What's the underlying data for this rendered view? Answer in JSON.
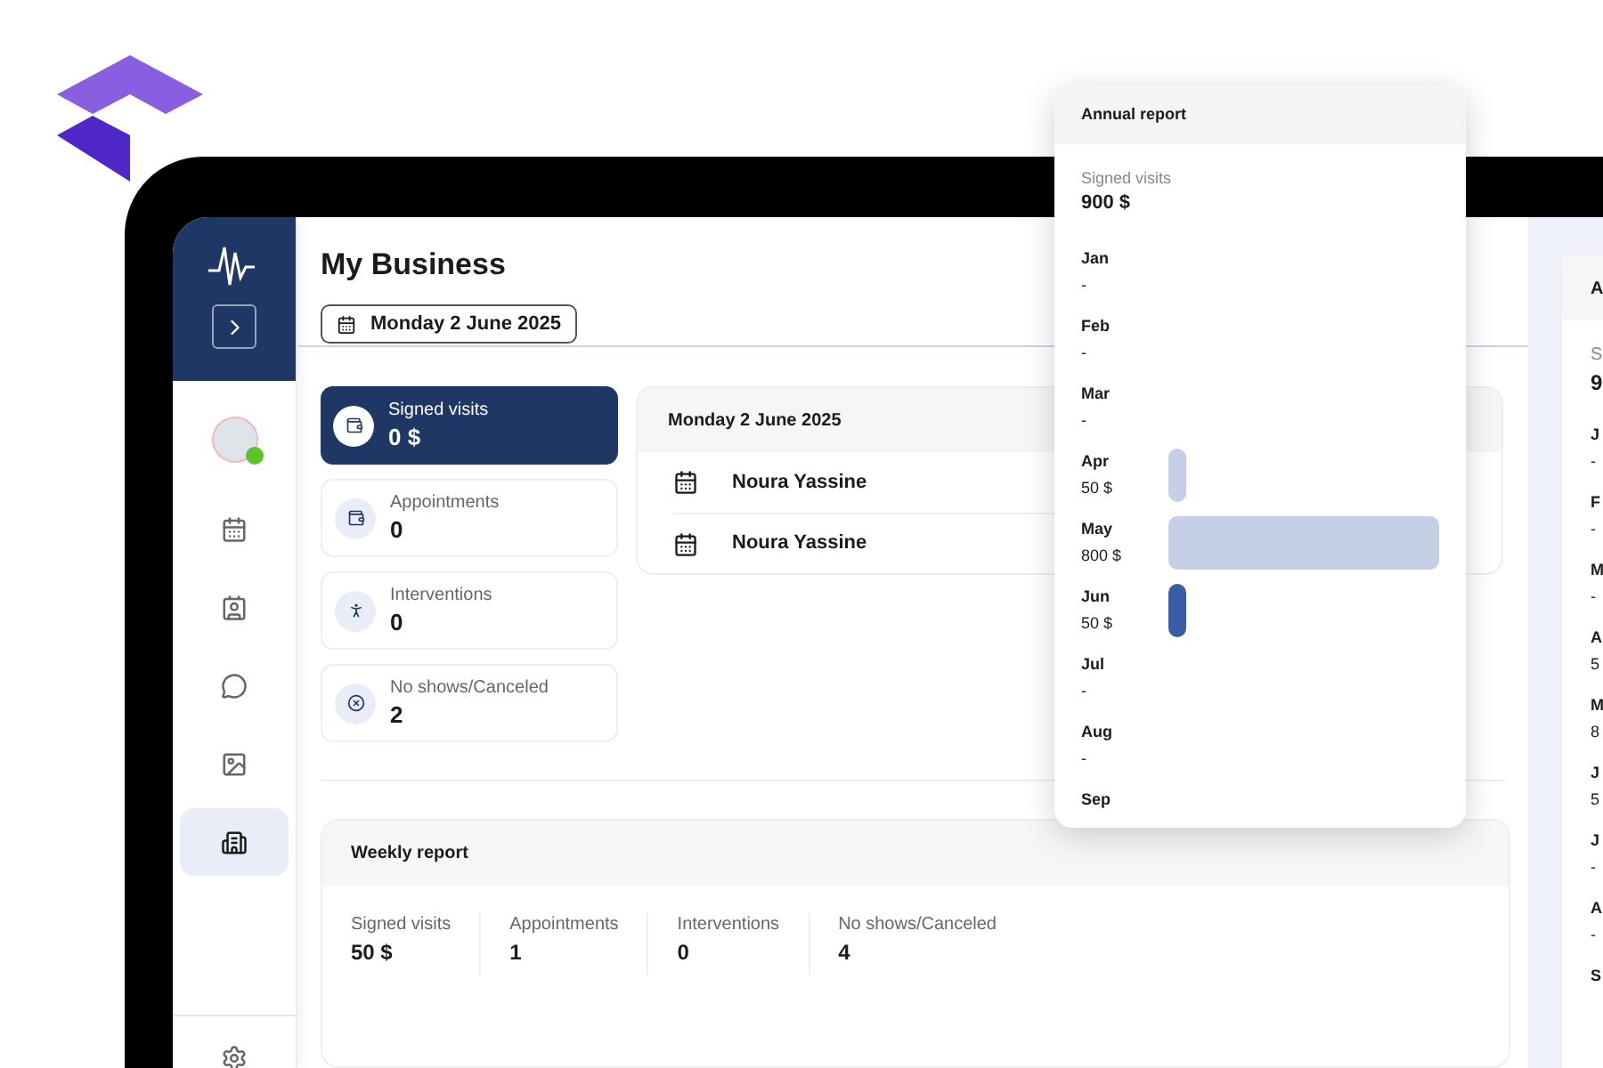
{
  "sidebar": {
    "avatar": {
      "online": true
    },
    "items": [
      {
        "selected": false
      },
      {
        "selected": false
      },
      {
        "selected": false
      },
      {
        "selected": false
      },
      {
        "selected": true
      }
    ]
  },
  "header": {
    "title": "My Business",
    "date": "Monday 2 June 2025"
  },
  "stats": [
    {
      "label": "Signed visits",
      "value": "0 $",
      "selected": true
    },
    {
      "label": "Appointments",
      "value": "0",
      "selected": false
    },
    {
      "label": "Interventions",
      "value": "0",
      "selected": false
    },
    {
      "label": "No shows/Canceled",
      "value": "2",
      "selected": false
    }
  ],
  "day_card": {
    "title": "Monday 2 June 2025",
    "rows": [
      "Noura Yassine",
      "Noura Yassine"
    ]
  },
  "weekly_report": {
    "title": "Weekly report",
    "stats": [
      {
        "label": "Signed visits",
        "value": "50 $"
      },
      {
        "label": "Appointments",
        "value": "1"
      },
      {
        "label": "Interventions",
        "value": "0"
      },
      {
        "label": "No shows/Canceled",
        "value": "4"
      }
    ]
  },
  "right_panel": {
    "title": "A",
    "summary_label": "S",
    "summary_value": "9",
    "months": [
      {
        "label": "J",
        "value": "-"
      },
      {
        "label": "F",
        "value": "-"
      },
      {
        "label": "M",
        "value": "-"
      },
      {
        "label": "A",
        "value": "5"
      },
      {
        "label": "M",
        "value": "8"
      },
      {
        "label": "J",
        "value": "5"
      },
      {
        "label": "J",
        "value": "-"
      },
      {
        "label": "A",
        "value": "-"
      },
      {
        "label": "S"
      }
    ]
  },
  "annual_report": {
    "title": "Annual report",
    "summary_label": "Signed visits",
    "summary_value": "900 $",
    "months": [
      {
        "label": "Jan",
        "value": "-"
      },
      {
        "label": "Feb",
        "value": "-"
      },
      {
        "label": "Mar",
        "value": "-"
      },
      {
        "label": "Apr",
        "value": "50 $"
      },
      {
        "label": "May",
        "value": "800 $"
      },
      {
        "label": "Jun",
        "value": "50 $"
      },
      {
        "label": "Jul",
        "value": "-"
      },
      {
        "label": "Aug",
        "value": "-"
      },
      {
        "label": "Sep"
      }
    ]
  }
}
